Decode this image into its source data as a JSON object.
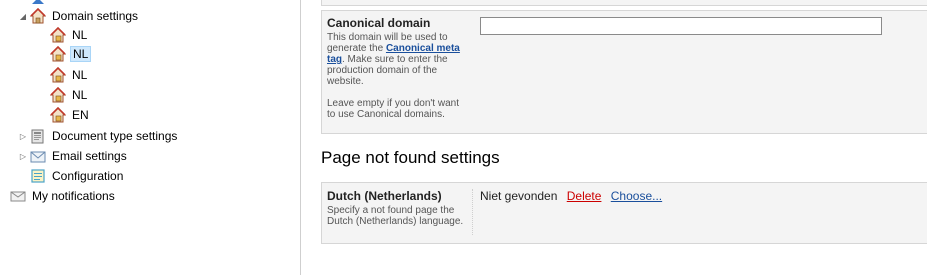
{
  "tree": {
    "domain_settings": "Domain settings",
    "domains": [
      "NL",
      "NL",
      "NL",
      "NL",
      "EN"
    ],
    "selected_index": 1,
    "document_type_settings": "Document type settings",
    "email_settings": "Email settings",
    "configuration": "Configuration",
    "my_notifications": "My notifications"
  },
  "canonical": {
    "title": "Canonical domain",
    "desc_before": "This domain will be used to generate the",
    "desc_link": "Canonical meta tag",
    "desc_after": ". Make sure to enter the production domain of the website.",
    "desc_2": "Leave empty if you don't want to use Canonical domains.",
    "value": ""
  },
  "not_found": {
    "heading": "Page not found settings",
    "language_title": "Dutch (Netherlands)",
    "language_desc": "Specify a not found page the Dutch (Netherlands) language.",
    "page_value": "Niet gevonden",
    "delete_label": "Delete",
    "choose_label": "Choose..."
  },
  "colors": {
    "selection": "#cfe8fc",
    "link": "#1a4f9c",
    "delete": "#cc0000",
    "panel": "#f4f4f4"
  }
}
